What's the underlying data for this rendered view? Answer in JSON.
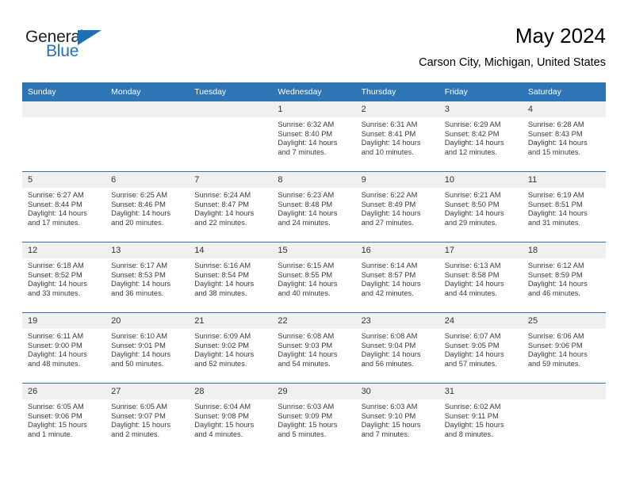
{
  "brand": {
    "name_part1": "General",
    "name_part2": "Blue",
    "logo_icon": "triangle-logo-icon",
    "accent_color": "#2272ba"
  },
  "header": {
    "title": "May 2024",
    "subtitle": "Carson City, Michigan, United States"
  },
  "theme": {
    "header_blue": "#2e75b6",
    "daynum_bg": "#f0f0f0",
    "text": "#3a3a3a"
  },
  "weekdays": [
    "Sunday",
    "Monday",
    "Tuesday",
    "Wednesday",
    "Thursday",
    "Friday",
    "Saturday"
  ],
  "labels": {
    "sunrise": "Sunrise:",
    "sunset": "Sunset:",
    "daylight": "Daylight:"
  },
  "weeks": [
    [
      {
        "day": "",
        "line1": "",
        "line2": "",
        "line3": "",
        "line4": ""
      },
      {
        "day": "",
        "line1": "",
        "line2": "",
        "line3": "",
        "line4": ""
      },
      {
        "day": "",
        "line1": "",
        "line2": "",
        "line3": "",
        "line4": ""
      },
      {
        "day": "1",
        "line1": "Sunrise: 6:32 AM",
        "line2": "Sunset: 8:40 PM",
        "line3": "Daylight: 14 hours",
        "line4": "and 7 minutes."
      },
      {
        "day": "2",
        "line1": "Sunrise: 6:31 AM",
        "line2": "Sunset: 8:41 PM",
        "line3": "Daylight: 14 hours",
        "line4": "and 10 minutes."
      },
      {
        "day": "3",
        "line1": "Sunrise: 6:29 AM",
        "line2": "Sunset: 8:42 PM",
        "line3": "Daylight: 14 hours",
        "line4": "and 12 minutes."
      },
      {
        "day": "4",
        "line1": "Sunrise: 6:28 AM",
        "line2": "Sunset: 8:43 PM",
        "line3": "Daylight: 14 hours",
        "line4": "and 15 minutes."
      }
    ],
    [
      {
        "day": "5",
        "line1": "Sunrise: 6:27 AM",
        "line2": "Sunset: 8:44 PM",
        "line3": "Daylight: 14 hours",
        "line4": "and 17 minutes."
      },
      {
        "day": "6",
        "line1": "Sunrise: 6:25 AM",
        "line2": "Sunset: 8:46 PM",
        "line3": "Daylight: 14 hours",
        "line4": "and 20 minutes."
      },
      {
        "day": "7",
        "line1": "Sunrise: 6:24 AM",
        "line2": "Sunset: 8:47 PM",
        "line3": "Daylight: 14 hours",
        "line4": "and 22 minutes."
      },
      {
        "day": "8",
        "line1": "Sunrise: 6:23 AM",
        "line2": "Sunset: 8:48 PM",
        "line3": "Daylight: 14 hours",
        "line4": "and 24 minutes."
      },
      {
        "day": "9",
        "line1": "Sunrise: 6:22 AM",
        "line2": "Sunset: 8:49 PM",
        "line3": "Daylight: 14 hours",
        "line4": "and 27 minutes."
      },
      {
        "day": "10",
        "line1": "Sunrise: 6:21 AM",
        "line2": "Sunset: 8:50 PM",
        "line3": "Daylight: 14 hours",
        "line4": "and 29 minutes."
      },
      {
        "day": "11",
        "line1": "Sunrise: 6:19 AM",
        "line2": "Sunset: 8:51 PM",
        "line3": "Daylight: 14 hours",
        "line4": "and 31 minutes."
      }
    ],
    [
      {
        "day": "12",
        "line1": "Sunrise: 6:18 AM",
        "line2": "Sunset: 8:52 PM",
        "line3": "Daylight: 14 hours",
        "line4": "and 33 minutes."
      },
      {
        "day": "13",
        "line1": "Sunrise: 6:17 AM",
        "line2": "Sunset: 8:53 PM",
        "line3": "Daylight: 14 hours",
        "line4": "and 36 minutes."
      },
      {
        "day": "14",
        "line1": "Sunrise: 6:16 AM",
        "line2": "Sunset: 8:54 PM",
        "line3": "Daylight: 14 hours",
        "line4": "and 38 minutes."
      },
      {
        "day": "15",
        "line1": "Sunrise: 6:15 AM",
        "line2": "Sunset: 8:55 PM",
        "line3": "Daylight: 14 hours",
        "line4": "and 40 minutes."
      },
      {
        "day": "16",
        "line1": "Sunrise: 6:14 AM",
        "line2": "Sunset: 8:57 PM",
        "line3": "Daylight: 14 hours",
        "line4": "and 42 minutes."
      },
      {
        "day": "17",
        "line1": "Sunrise: 6:13 AM",
        "line2": "Sunset: 8:58 PM",
        "line3": "Daylight: 14 hours",
        "line4": "and 44 minutes."
      },
      {
        "day": "18",
        "line1": "Sunrise: 6:12 AM",
        "line2": "Sunset: 8:59 PM",
        "line3": "Daylight: 14 hours",
        "line4": "and 46 minutes."
      }
    ],
    [
      {
        "day": "19",
        "line1": "Sunrise: 6:11 AM",
        "line2": "Sunset: 9:00 PM",
        "line3": "Daylight: 14 hours",
        "line4": "and 48 minutes."
      },
      {
        "day": "20",
        "line1": "Sunrise: 6:10 AM",
        "line2": "Sunset: 9:01 PM",
        "line3": "Daylight: 14 hours",
        "line4": "and 50 minutes."
      },
      {
        "day": "21",
        "line1": "Sunrise: 6:09 AM",
        "line2": "Sunset: 9:02 PM",
        "line3": "Daylight: 14 hours",
        "line4": "and 52 minutes."
      },
      {
        "day": "22",
        "line1": "Sunrise: 6:08 AM",
        "line2": "Sunset: 9:03 PM",
        "line3": "Daylight: 14 hours",
        "line4": "and 54 minutes."
      },
      {
        "day": "23",
        "line1": "Sunrise: 6:08 AM",
        "line2": "Sunset: 9:04 PM",
        "line3": "Daylight: 14 hours",
        "line4": "and 56 minutes."
      },
      {
        "day": "24",
        "line1": "Sunrise: 6:07 AM",
        "line2": "Sunset: 9:05 PM",
        "line3": "Daylight: 14 hours",
        "line4": "and 57 minutes."
      },
      {
        "day": "25",
        "line1": "Sunrise: 6:06 AM",
        "line2": "Sunset: 9:06 PM",
        "line3": "Daylight: 14 hours",
        "line4": "and 59 minutes."
      }
    ],
    [
      {
        "day": "26",
        "line1": "Sunrise: 6:05 AM",
        "line2": "Sunset: 9:06 PM",
        "line3": "Daylight: 15 hours",
        "line4": "and 1 minute."
      },
      {
        "day": "27",
        "line1": "Sunrise: 6:05 AM",
        "line2": "Sunset: 9:07 PM",
        "line3": "Daylight: 15 hours",
        "line4": "and 2 minutes."
      },
      {
        "day": "28",
        "line1": "Sunrise: 6:04 AM",
        "line2": "Sunset: 9:08 PM",
        "line3": "Daylight: 15 hours",
        "line4": "and 4 minutes."
      },
      {
        "day": "29",
        "line1": "Sunrise: 6:03 AM",
        "line2": "Sunset: 9:09 PM",
        "line3": "Daylight: 15 hours",
        "line4": "and 5 minutes."
      },
      {
        "day": "30",
        "line1": "Sunrise: 6:03 AM",
        "line2": "Sunset: 9:10 PM",
        "line3": "Daylight: 15 hours",
        "line4": "and 7 minutes."
      },
      {
        "day": "31",
        "line1": "Sunrise: 6:02 AM",
        "line2": "Sunset: 9:11 PM",
        "line3": "Daylight: 15 hours",
        "line4": "and 8 minutes."
      },
      {
        "day": "",
        "line1": "",
        "line2": "",
        "line3": "",
        "line4": ""
      }
    ]
  ]
}
